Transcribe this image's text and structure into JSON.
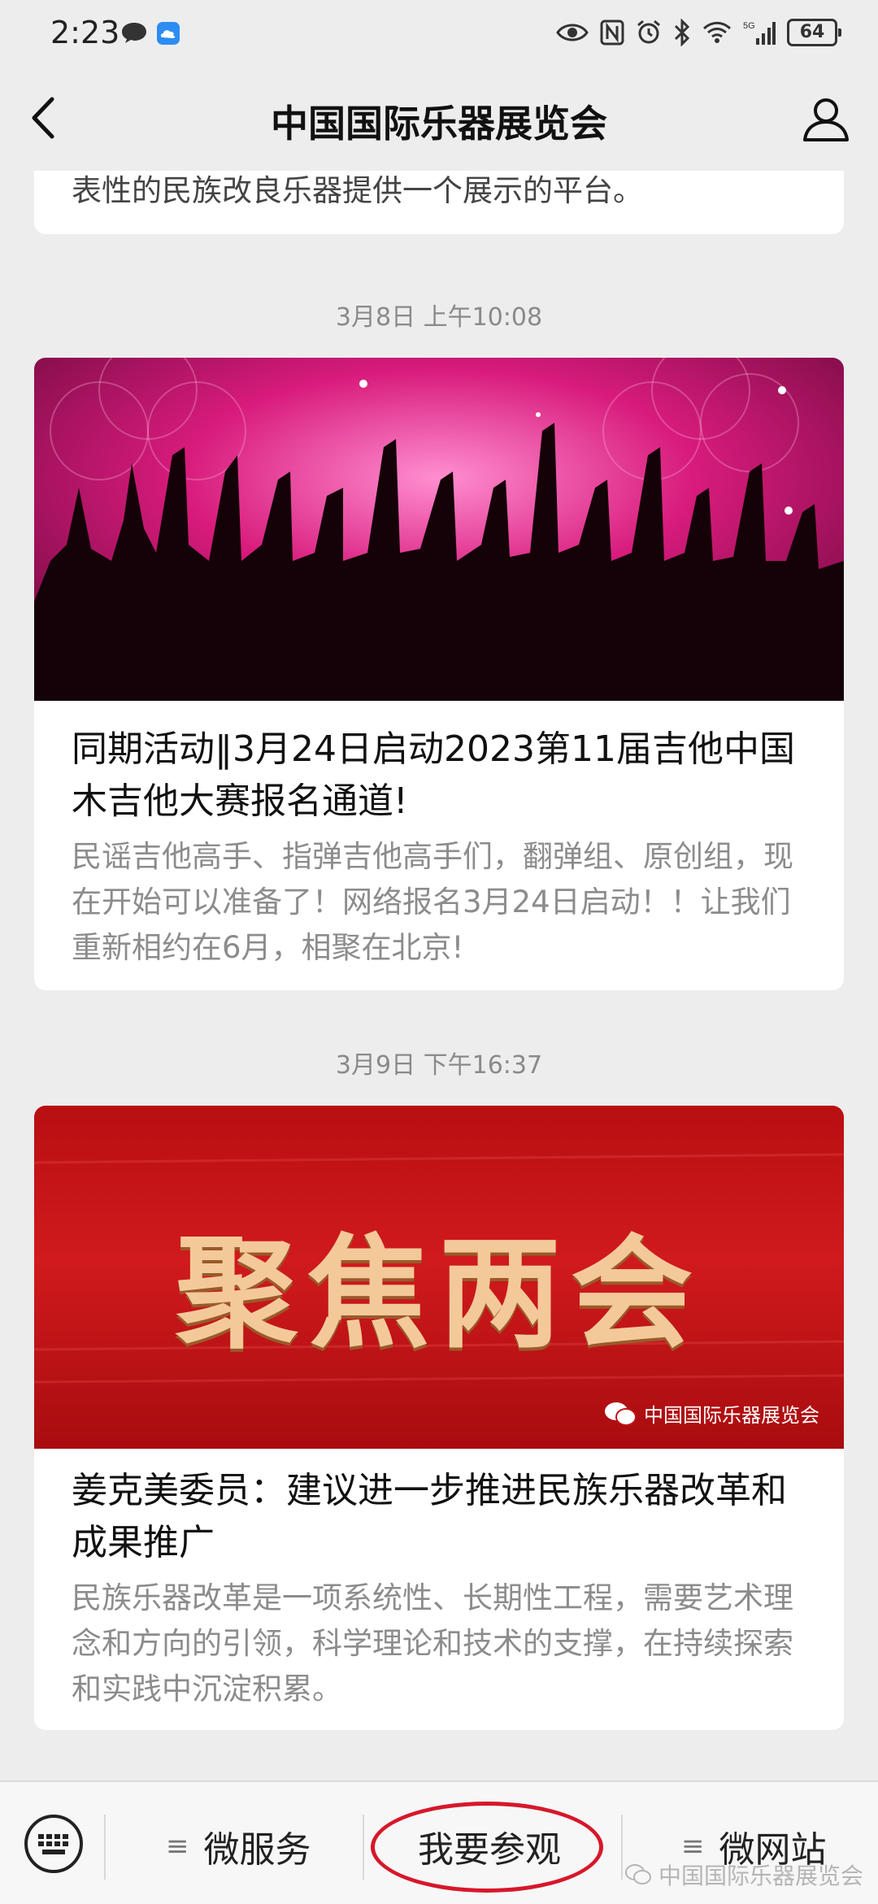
{
  "status_bar": {
    "time": "2:23",
    "battery": "64",
    "signal_label": "5G"
  },
  "nav": {
    "title": "中国国际乐器展览会"
  },
  "feed": {
    "first_card_tail": "表性的民族改良乐器提供一个展示的平台。",
    "articles": [
      {
        "timestamp": "3月8日 上午10:08",
        "title": "同期活动‖3月24日启动2023第11届吉他中国木吉他大赛报名通道!",
        "excerpt": "民谣吉他高手、指弹吉他高手们，翻弹组、原创组，现在开始可以准备了！网络报名3月24日启动！！让我们重新相约在6月，相聚在北京!"
      },
      {
        "timestamp": "3月9日 下午16:37",
        "title": "姜克美委员：建议进一步推进民族乐器改革和成果推广",
        "excerpt": "民族乐器改革是一项系统性、长期性工程，需要艺术理念和方向的引领，科学理论和技术的支撑，在持续探索和实践中沉淀积累。",
        "cover_text": "聚焦两会",
        "cover_brand": "中国国际乐器展览会"
      }
    ]
  },
  "bottom_menu": {
    "items": [
      "微服务",
      "我要参观",
      "微网站"
    ],
    "watermark": "中国国际乐器展览会"
  },
  "colors": {
    "accent_red": "#d6182a",
    "concert_magenta": "#c2186b"
  }
}
